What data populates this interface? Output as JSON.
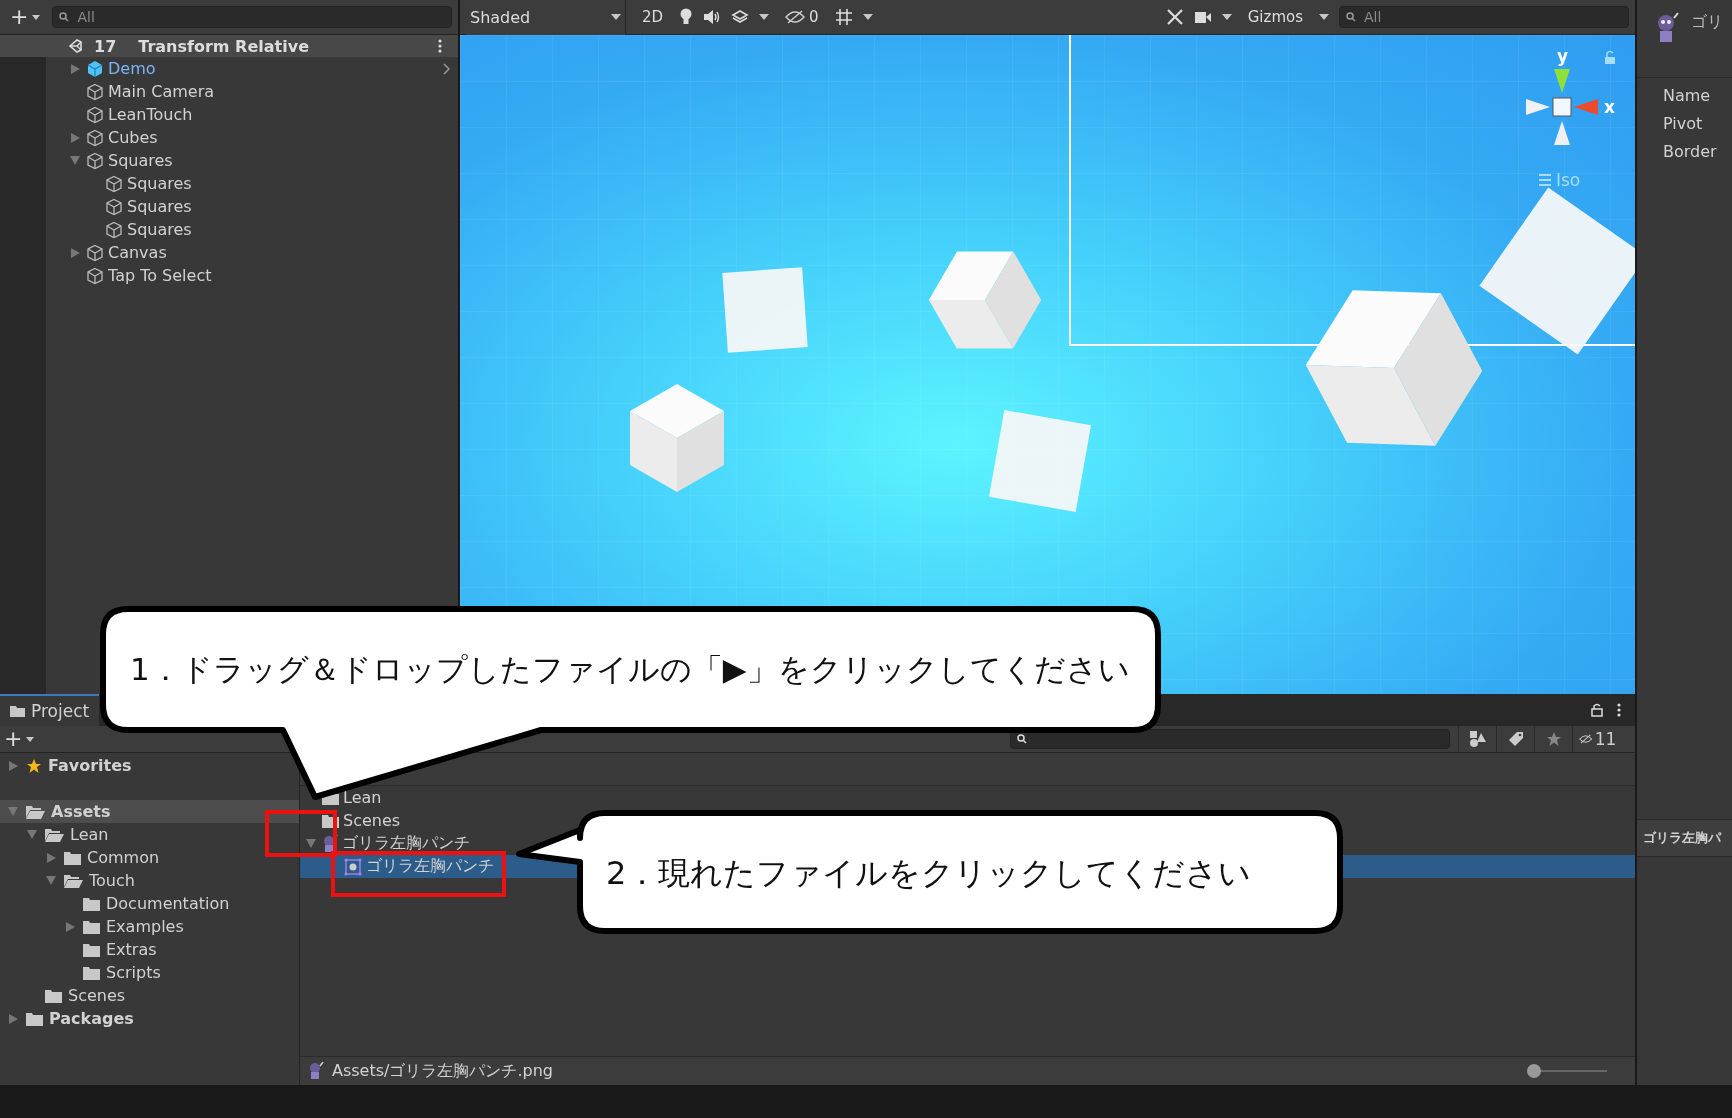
{
  "hierarchy": {
    "add_button": "+",
    "search": {
      "placeholder": "All"
    },
    "scene": {
      "number": "17",
      "name": "Transform Relative"
    },
    "items": [
      {
        "label": "Demo",
        "prefab": true,
        "expandable": true,
        "expanded": false
      },
      {
        "label": "Main Camera",
        "prefab": false,
        "expandable": false
      },
      {
        "label": "LeanTouch",
        "prefab": false,
        "expandable": false
      },
      {
        "label": "Cubes",
        "prefab": false,
        "expandable": true,
        "expanded": false
      },
      {
        "label": "Squares",
        "prefab": false,
        "expandable": true,
        "expanded": true,
        "children": [
          {
            "label": "Squares",
            "prefab": false,
            "expandable": false
          },
          {
            "label": "Squares",
            "prefab": false,
            "expandable": false
          },
          {
            "label": "Squares",
            "prefab": false,
            "expandable": false
          }
        ]
      },
      {
        "label": "Canvas",
        "prefab": false,
        "expandable": true,
        "expanded": false
      },
      {
        "label": "Tap To Select",
        "prefab": false,
        "expandable": false
      }
    ]
  },
  "scene_toolbar": {
    "shading": "Shaded",
    "mode_2d": "2D",
    "hidden_count": "0",
    "gizmos": "Gizmos",
    "search": {
      "placeholder": "All"
    }
  },
  "scene_view": {
    "y_label": "y",
    "x_label": "x",
    "projection": "Iso"
  },
  "inspector": {
    "title": "ゴリ",
    "fields": [
      "Name",
      "Pivot",
      "Border"
    ],
    "section": "ゴリラ左胸パ"
  },
  "project": {
    "tab": "Project",
    "add_button": "+",
    "filter_count": "11",
    "tree": [
      {
        "label": "Favorites",
        "kind": "favorites",
        "expandable": true,
        "expanded": false,
        "selected": false
      },
      {
        "label": "Assets",
        "kind": "folder",
        "expandable": true,
        "expanded": true,
        "selected": true,
        "children": [
          {
            "label": "Lean",
            "kind": "folder",
            "expandable": true,
            "expanded": true,
            "selected": false,
            "children": [
              {
                "label": "Common",
                "kind": "folder",
                "expandable": true,
                "expanded": false,
                "selected": false
              },
              {
                "label": "Touch",
                "kind": "folder",
                "expandable": true,
                "expanded": true,
                "selected": false,
                "children": [
                  {
                    "label": "Documentation",
                    "kind": "folder",
                    "expandable": false,
                    "selected": false
                  },
                  {
                    "label": "Examples",
                    "kind": "folder",
                    "expandable": true,
                    "expanded": false,
                    "selected": false
                  },
                  {
                    "label": "Extras",
                    "kind": "folder",
                    "expandable": false,
                    "selected": false
                  },
                  {
                    "label": "Scripts",
                    "kind": "folder",
                    "expandable": false,
                    "selected": false
                  }
                ]
              }
            ]
          },
          {
            "label": "Scenes",
            "kind": "folder",
            "expandable": false,
            "selected": false
          }
        ]
      },
      {
        "label": "Packages",
        "kind": "folder",
        "expandable": true,
        "expanded": false,
        "selected": false
      }
    ],
    "files": [
      {
        "label": "Lean",
        "kind": "folder",
        "expandable": false,
        "selected": false
      },
      {
        "label": "Scenes",
        "kind": "folder",
        "expandable": false,
        "selected": false
      },
      {
        "label": "ゴリラ左胸パンチ",
        "kind": "texture",
        "expandable": true,
        "expanded": true,
        "selected": false,
        "children": [
          {
            "label": "ゴリラ左胸パンチ",
            "kind": "sprite",
            "expandable": false,
            "selected": true
          }
        ]
      }
    ],
    "status": {
      "path": "Assets/ゴリラ左胸パンチ.png",
      "zoom_slider": {
        "level": 0
      }
    }
  },
  "callouts": [
    {
      "text": "1．ドラッグ＆ドロップしたファイルの「▶」をクリックしてください"
    },
    {
      "text": "2．現れたファイルをクリックしてください"
    }
  ]
}
